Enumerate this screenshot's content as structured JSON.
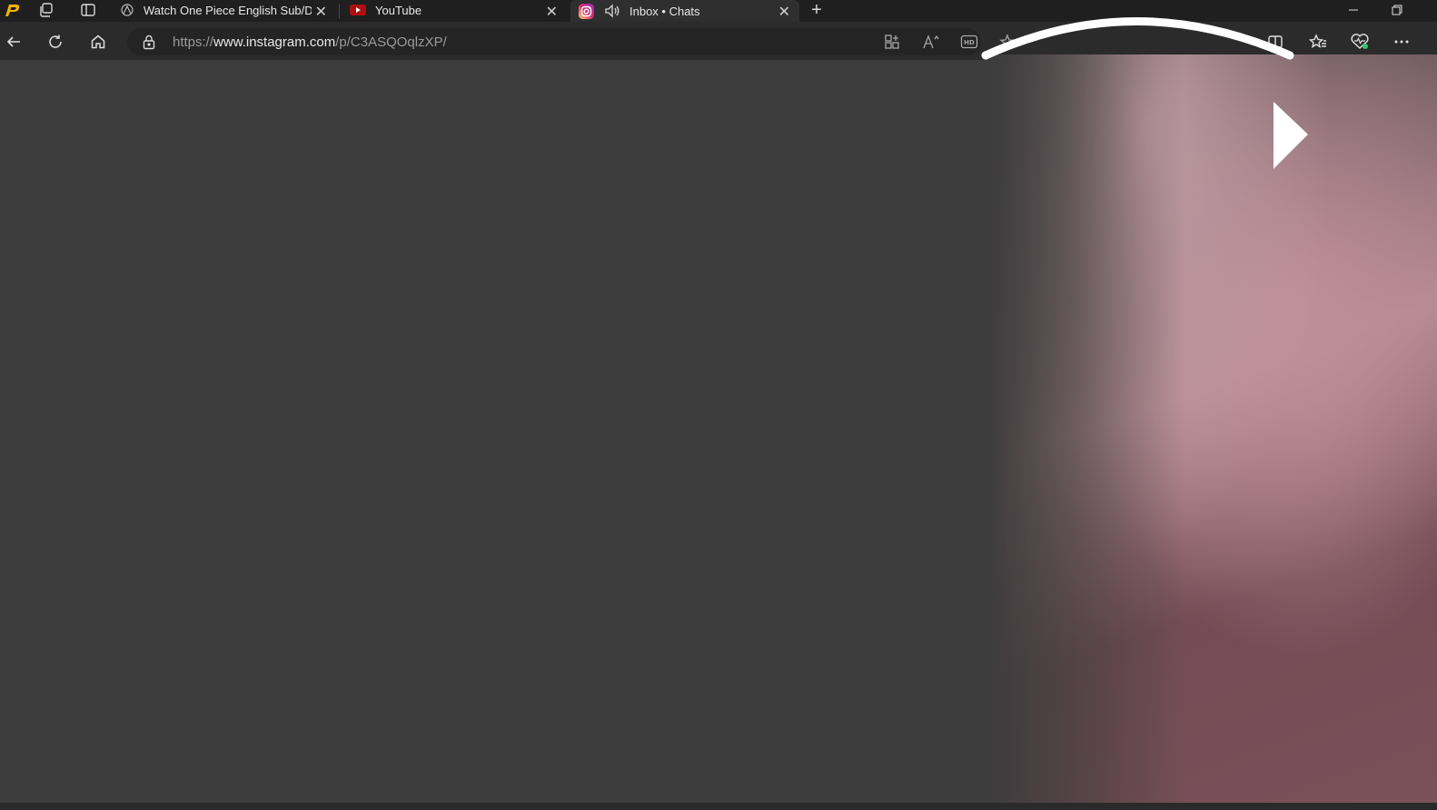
{
  "tabs": [
    {
      "label": "Watch One Piece English Sub/Du",
      "icon": "anime-site-icon",
      "active": false
    },
    {
      "label": "YouTube",
      "icon": "youtube-icon",
      "active": false
    },
    {
      "label": "Inbox • Chats",
      "icon": "instagram-icon",
      "active": true,
      "audio": "speaker-icon"
    }
  ],
  "address": {
    "scheme": "https://",
    "host": "www.instagram.com",
    "path": "/p/C3ASQOqlzXP/"
  },
  "colors": {
    "tabbar_bg": "#1f1f1f",
    "toolbar_bg": "#2b2b2b",
    "content_bg": "#3c3c3c",
    "youtube_red": "#ff0000",
    "instagram_gradient": [
      "#feda75",
      "#d62976",
      "#962fbf"
    ],
    "copilot_green": "#2dc86a"
  },
  "toolbar_icons": [
    "back-icon",
    "refresh-icon",
    "home-icon",
    "lock-icon",
    "apps-icon",
    "read-aloud-icon",
    "hd-icon",
    "favorite-star-icon",
    "split-screen-icon",
    "favorites-icon",
    "browser-essentials-icon",
    "more-icon"
  ]
}
